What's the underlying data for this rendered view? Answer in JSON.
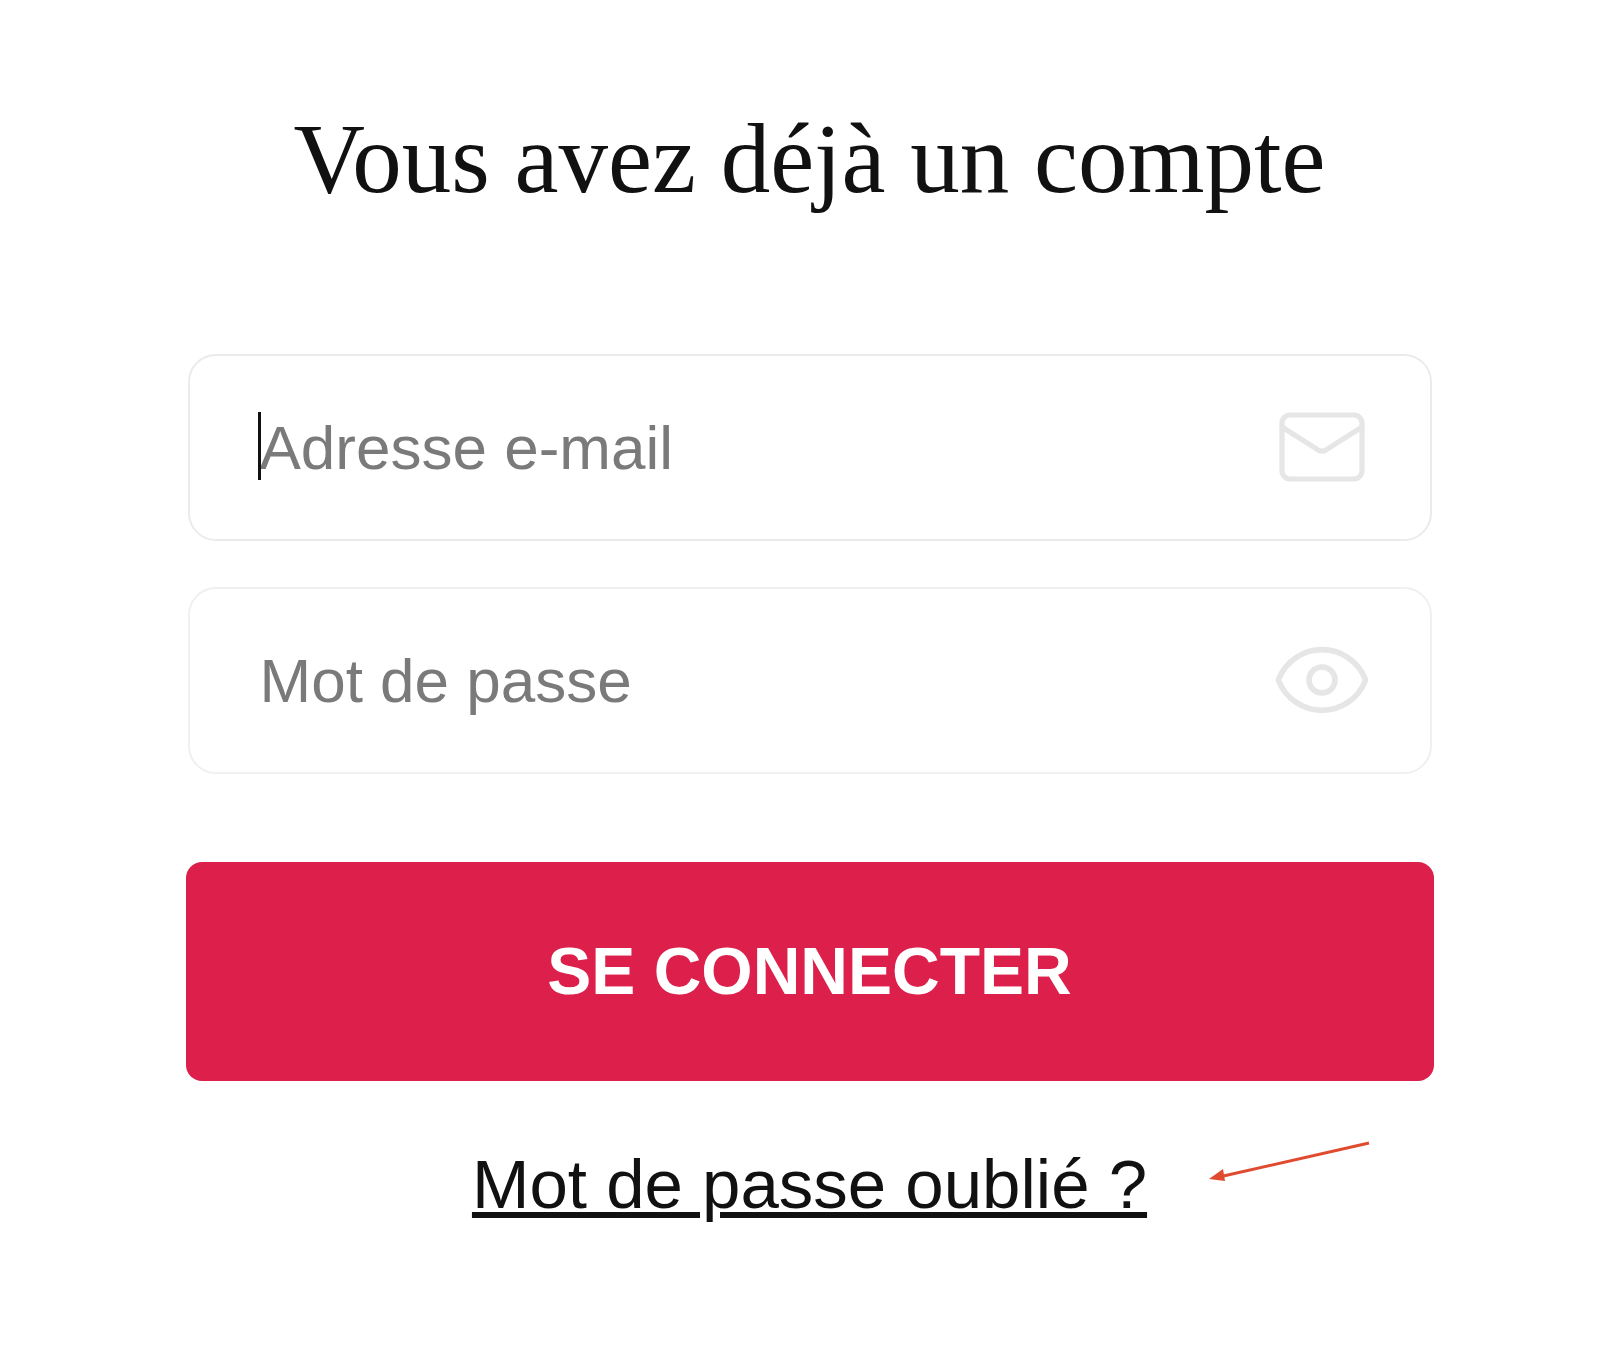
{
  "title": "Vous avez déjà un compte",
  "fields": [
    {
      "kind": "email",
      "placeholder": "Adresse e-mail",
      "focused": true
    },
    {
      "kind": "password",
      "placeholder": "Mot de passe",
      "focused": false
    }
  ],
  "submit": {
    "label": "SE CONNECTER"
  },
  "forgot_link": {
    "label": "Mot de passe oublié ?"
  }
}
